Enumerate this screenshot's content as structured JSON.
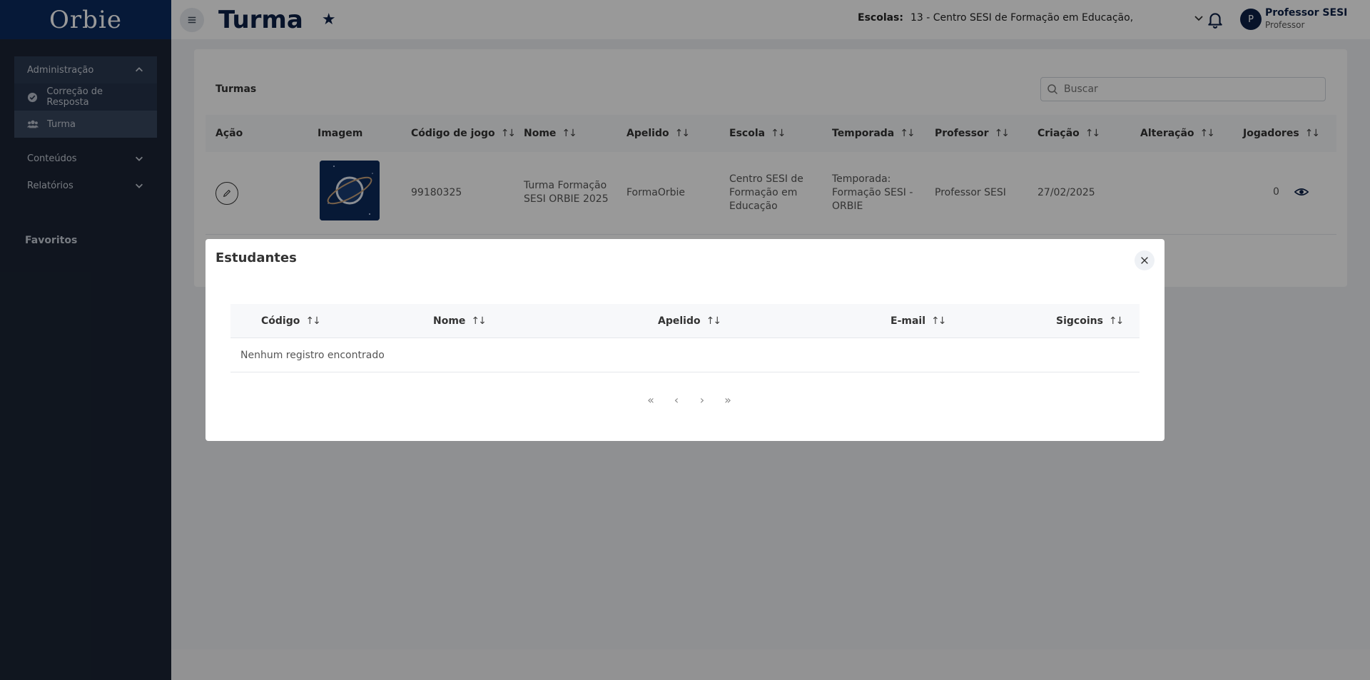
{
  "sidebar": {
    "brand": "Orbie",
    "groups": [
      {
        "label": "Administração",
        "expanded": true,
        "items": [
          {
            "label": "Correção de Resposta",
            "icon": "check-circle-icon"
          },
          {
            "label": "Turma",
            "icon": "users-icon",
            "active": true
          }
        ]
      },
      {
        "label": "Conteúdos",
        "expanded": false
      },
      {
        "label": "Relatórios",
        "expanded": false
      }
    ],
    "favorites_title": "Favoritos"
  },
  "header": {
    "title": "Turma",
    "escolas_label": "Escolas:",
    "escolas_value": "13 - Centro SESI de Formação em Educação,",
    "user_initial": "P",
    "user_name": "Professor SESI",
    "user_role": "Professor"
  },
  "turmas": {
    "title": "Turmas",
    "search_placeholder": "Buscar",
    "columns": [
      "Ação",
      "Imagem",
      "Código de jogo",
      "Nome",
      "Apelido",
      "Escola",
      "Temporada",
      "Professor",
      "Criação",
      "Alteração",
      "Jogadores"
    ],
    "rows": [
      {
        "codigo": "99180325",
        "nome": "Turma Formação SESI ORBIE 2025",
        "apelido": "FormaOrbie",
        "escola": "Centro SESI de Formação em Educação",
        "temporada": "Temporada: Formação SESI - ORBIE",
        "professor": "Professor SESI",
        "criacao": "27/02/2025",
        "alteracao": "",
        "jogadores": "0"
      }
    ]
  },
  "modal": {
    "title": "Estudantes",
    "columns": [
      "Código",
      "Nome",
      "Apelido",
      "E-mail",
      "Sigcoins"
    ],
    "empty_message": "Nenhum registro encontrado",
    "pager": {
      "first": "«",
      "prev": "‹",
      "next": "›",
      "last": "»"
    }
  },
  "colors": {
    "sidebar_bg": "#1b2434",
    "brand_bg": "#0a2a5e",
    "accent": "#0d2147"
  }
}
